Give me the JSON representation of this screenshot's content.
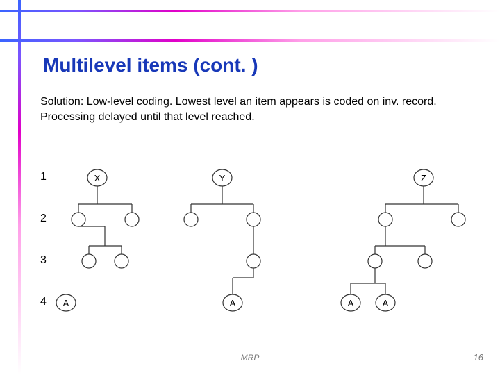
{
  "title": "Multilevel items (cont. )",
  "body": "Solution:  Low-level coding.  Lowest level an item appears is coded on inv. record.  Processing delayed until that level reached.",
  "levels": [
    "1",
    "2",
    "3",
    "4"
  ],
  "nodes": {
    "X": "X",
    "Y": "Y",
    "Z": "Z",
    "A": "A"
  },
  "footer": {
    "center": "MRP",
    "page": "16"
  },
  "chart_data": {
    "type": "tree-diagram",
    "levels": [
      1,
      2,
      3,
      4
    ],
    "trees": [
      {
        "root": {
          "label": "X",
          "level": 1
        },
        "children": [
          {
            "label": "",
            "level": 2,
            "children": [
              {
                "label": "",
                "level": 3
              },
              {
                "label": "",
                "level": 3
              }
            ]
          },
          {
            "label": "",
            "level": 2,
            "children": [
              {
                "label": "A",
                "level": 4
              }
            ]
          }
        ]
      },
      {
        "root": {
          "label": "Y",
          "level": 1
        },
        "children": [
          {
            "label": "",
            "level": 2
          },
          {
            "label": "",
            "level": 2,
            "children": [
              {
                "label": "",
                "level": 3,
                "children": [
                  {
                    "label": "A",
                    "level": 4
                  }
                ]
              }
            ]
          }
        ]
      },
      {
        "root": {
          "label": "Z",
          "level": 1
        },
        "children": [
          {
            "label": "",
            "level": 2,
            "children": [
              {
                "label": "",
                "level": 3,
                "children": [
                  {
                    "label": "A",
                    "level": 4
                  },
                  {
                    "label": "A",
                    "level": 4
                  }
                ]
              },
              {
                "label": "",
                "level": 3
              }
            ]
          },
          {
            "label": "",
            "level": 2
          }
        ]
      }
    ]
  }
}
